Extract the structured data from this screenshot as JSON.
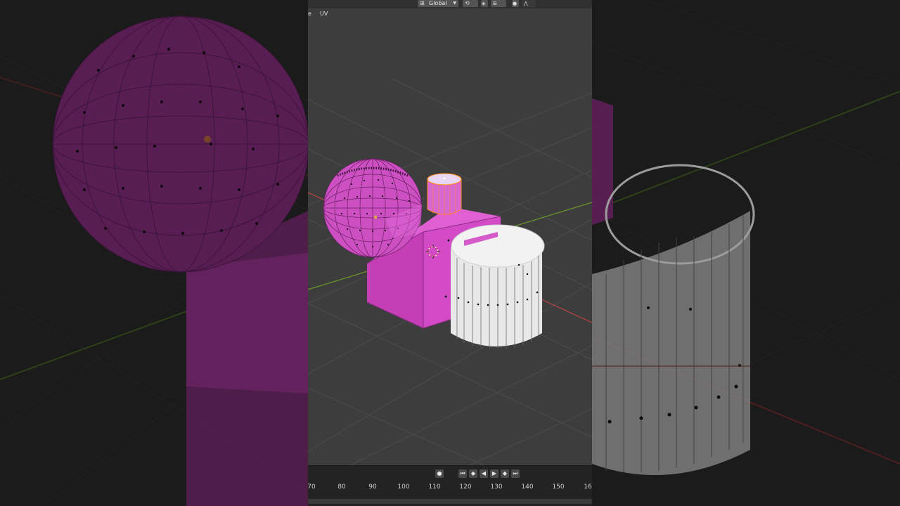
{
  "header": {
    "orientation": "Global",
    "mode_fragment": "e",
    "uv_menu": "UV"
  },
  "timeline": {
    "ruler_labels": [
      "70",
      "80",
      "90",
      "100",
      "110",
      "120",
      "130",
      "140",
      "150",
      "16"
    ]
  },
  "colors": {
    "viewport_bg": "#3d3d3d",
    "grid": "#4a4a4a",
    "x_axis": "#c04545",
    "y_axis": "#6a9a2a",
    "mesh_pink": "#d24ac6",
    "mesh_pink_dark": "#b238a6",
    "cylinder_white": "#e6e6e6",
    "selected_orange": "#ff8a1a",
    "timeline_bg": "#232323"
  },
  "icons": [
    "global-orientation-icon",
    "pivot-icon",
    "snap-icon",
    "proportional-editing-icon",
    "record-icon",
    "jump-start-icon",
    "prev-keyframe-icon",
    "play-reverse-icon",
    "play-icon",
    "next-keyframe-icon",
    "jump-end-icon",
    "3d-cursor-icon"
  ]
}
